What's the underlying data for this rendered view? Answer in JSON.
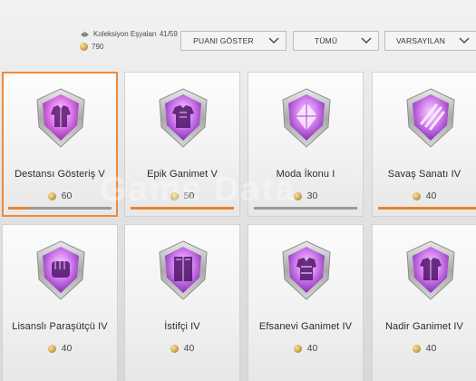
{
  "collection": {
    "label": "Koleksiyon Eşyaları",
    "count": "41/59",
    "coins": "790"
  },
  "filters": [
    {
      "label": "PUANI GÖSTER"
    },
    {
      "label": "TÜMÜ"
    },
    {
      "label": "VARSAYILAN"
    }
  ],
  "watermark": "Game Data",
  "cards": [
    {
      "name": "Destansı Gösteriş V",
      "points": "60",
      "progress": 0.2,
      "selected": true,
      "badge": "jacket-badge-icon"
    },
    {
      "name": "Epik Ganimet V",
      "points": "50",
      "progress": 1.0,
      "selected": false,
      "badge": "outfit-badge-icon"
    },
    {
      "name": "Moda İkonu I",
      "points": "30",
      "progress": 0.0,
      "selected": false,
      "badge": "diamond-badge-icon"
    },
    {
      "name": "Savaş Sanatı IV",
      "points": "40",
      "progress": 1.0,
      "selected": false,
      "badge": "claw-badge-icon"
    },
    {
      "name": "Lisanslı Paraşütçü IV",
      "points": "40",
      "progress": null,
      "selected": false,
      "badge": "fist-badge-icon"
    },
    {
      "name": "İstifçi IV",
      "points": "40",
      "progress": null,
      "selected": false,
      "badge": "locker-badge-icon"
    },
    {
      "name": "Efsanevi Ganimet IV",
      "points": "40",
      "progress": null,
      "selected": false,
      "badge": "armor-badge-icon"
    },
    {
      "name": "Nadir Ganimet IV",
      "points": "40",
      "progress": null,
      "selected": false,
      "badge": "shirt-badge-icon"
    }
  ],
  "colors": {
    "accent": "#e8832f",
    "badge_purple": "#b84fd8",
    "badge_frame": "#b9b9b9"
  }
}
